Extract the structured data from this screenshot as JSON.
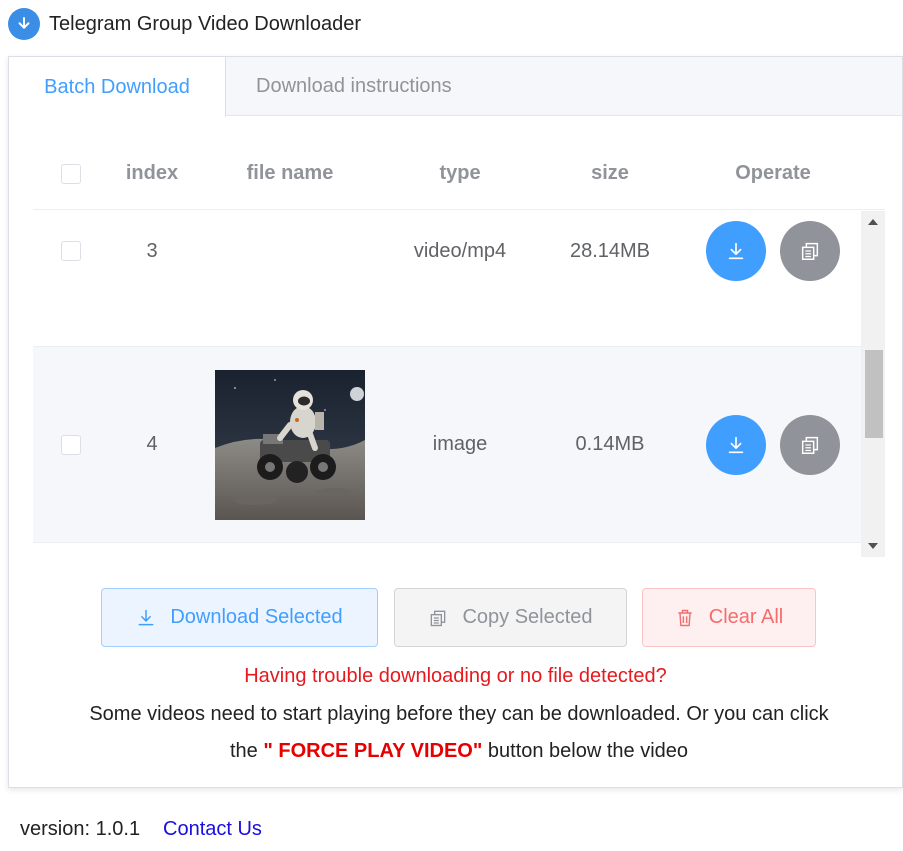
{
  "header": {
    "title": "Telegram Group Video Downloader",
    "logo_icon": "download-circle-icon"
  },
  "tabs": [
    {
      "label": "Batch Download",
      "active": true
    },
    {
      "label": "Download instructions",
      "active": false
    }
  ],
  "table": {
    "columns": {
      "index": "index",
      "file_name": "file name",
      "type": "type",
      "size": "size",
      "operate": "Operate"
    },
    "rows": [
      {
        "index": "3",
        "file_name": "",
        "type": "video/mp4",
        "size": "28.14MB",
        "has_thumbnail": false
      },
      {
        "index": "4",
        "file_name": "",
        "type": "image",
        "size": "0.14MB",
        "has_thumbnail": true,
        "thumbnail_desc": "astronaut-rover-moon-thumbnail"
      }
    ]
  },
  "actions": {
    "download_selected": "Download Selected",
    "copy_selected": "Copy Selected",
    "clear_all": "Clear All"
  },
  "help": {
    "title": "Having trouble downloading or no file detected?",
    "line1": "Some videos need to start playing before they can be downloaded. Or you can click",
    "line2_prefix": "the ",
    "force_label": "\" FORCE PLAY VIDEO\"",
    "line2_suffix": " button below the video"
  },
  "footer": {
    "version": "version: 1.0.1",
    "contact": "Contact Us"
  },
  "colors": {
    "primary": "#409eff",
    "danger": "#f56c6c",
    "info": "#909399",
    "warning_text": "#e6191e"
  }
}
